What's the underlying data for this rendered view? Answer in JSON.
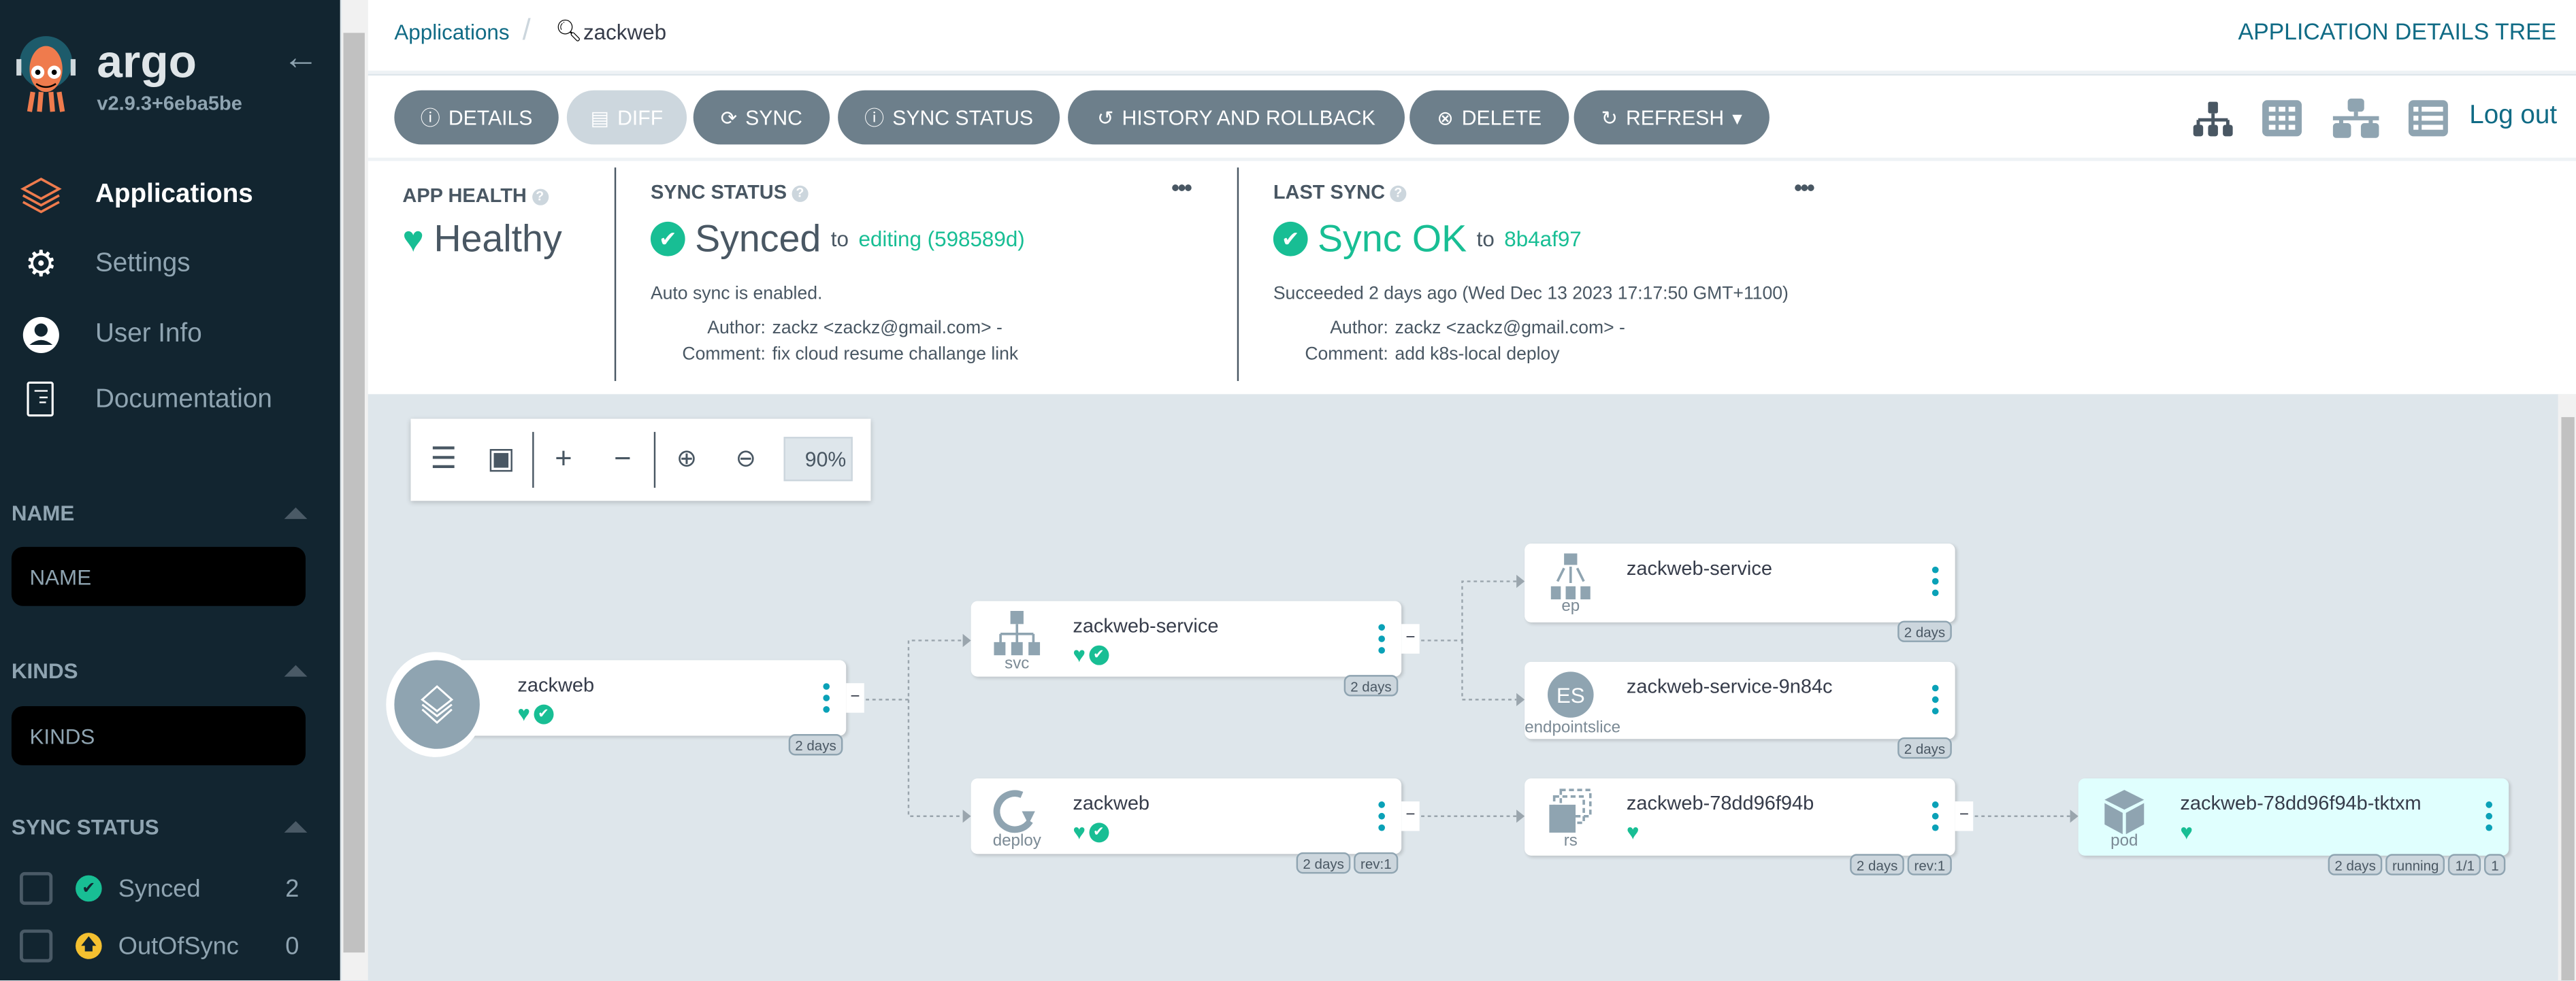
{
  "sidebar": {
    "brand": "argo",
    "version": "v2.9.3+6eba5be",
    "nav": [
      {
        "label": "Applications",
        "icon": "layers-icon",
        "active": true
      },
      {
        "label": "Settings",
        "icon": "gears-icon"
      },
      {
        "label": "User Info",
        "icon": "user-circle-icon"
      },
      {
        "label": "Documentation",
        "icon": "book-icon"
      }
    ],
    "filters": {
      "name": {
        "label": "NAME",
        "placeholder": "NAME"
      },
      "kinds": {
        "label": "KINDS",
        "placeholder": "KINDS"
      },
      "sync_status": {
        "label": "SYNC STATUS",
        "options": [
          {
            "label": "Synced",
            "count": "2",
            "color": "#18be94"
          },
          {
            "label": "OutOfSync",
            "count": "0",
            "color": "#f4c030"
          }
        ]
      }
    }
  },
  "header": {
    "breadcrumb_root": "Applications",
    "breadcrumb_current": "zackweb",
    "page_title": "APPLICATION DETAILS TREE",
    "logout": "Log out"
  },
  "toolbar": {
    "details": "DETAILS",
    "diff": "DIFF",
    "sync": "SYNC",
    "sync_status": "SYNC STATUS",
    "history": "HISTORY AND ROLLBACK",
    "delete": "DELETE",
    "refresh": "REFRESH"
  },
  "status": {
    "health": {
      "label": "APP HEALTH",
      "value": "Healthy"
    },
    "sync": {
      "label": "SYNC STATUS",
      "value": "Synced",
      "to": "to",
      "target": "editing (598589d)",
      "auto": "Auto sync is enabled.",
      "author_label": "Author:",
      "author": "zackz <zackz@gmail.com> -",
      "comment_label": "Comment:",
      "comment": "fix cloud resume challange link"
    },
    "last_sync": {
      "label": "LAST SYNC",
      "value": "Sync OK",
      "to": "to",
      "target": "8b4af97",
      "succeeded": "Succeeded 2 days ago (Wed Dec 13 2023 17:17:50 GMT+1100)",
      "author_label": "Author:",
      "author": "zackz <zackz@gmail.com> -",
      "comment_label": "Comment:",
      "comment": "add k8s-local deploy"
    }
  },
  "zoom": {
    "level": "90%"
  },
  "colors": {
    "sidebar": "#122530",
    "accent": "#106b85",
    "healthy": "#18be94",
    "button": "#6d7f8b",
    "pod_bg": "#e0fffe"
  },
  "nodes": {
    "app": {
      "name": "zackweb",
      "badges": [
        "2 days"
      ]
    },
    "svc": {
      "name": "zackweb-service",
      "kind": "svc",
      "badges": [
        "2 days"
      ]
    },
    "deploy": {
      "name": "zackweb",
      "kind": "deploy",
      "badges": [
        "2 days",
        "rev:1"
      ]
    },
    "ep": {
      "name": "zackweb-service",
      "kind": "ep",
      "badges": [
        "2 days"
      ]
    },
    "es": {
      "name": "zackweb-service-9n84c",
      "kind": "endpointslice",
      "icon_text": "ES",
      "badges": [
        "2 days"
      ]
    },
    "rs": {
      "name": "zackweb-78dd96f94b",
      "kind": "rs",
      "badges": [
        "2 days",
        "rev:1"
      ]
    },
    "pod": {
      "name": "zackweb-78dd96f94b-tktxm",
      "kind": "pod",
      "badges": [
        "2 days",
        "running",
        "1/1",
        "1"
      ]
    }
  }
}
